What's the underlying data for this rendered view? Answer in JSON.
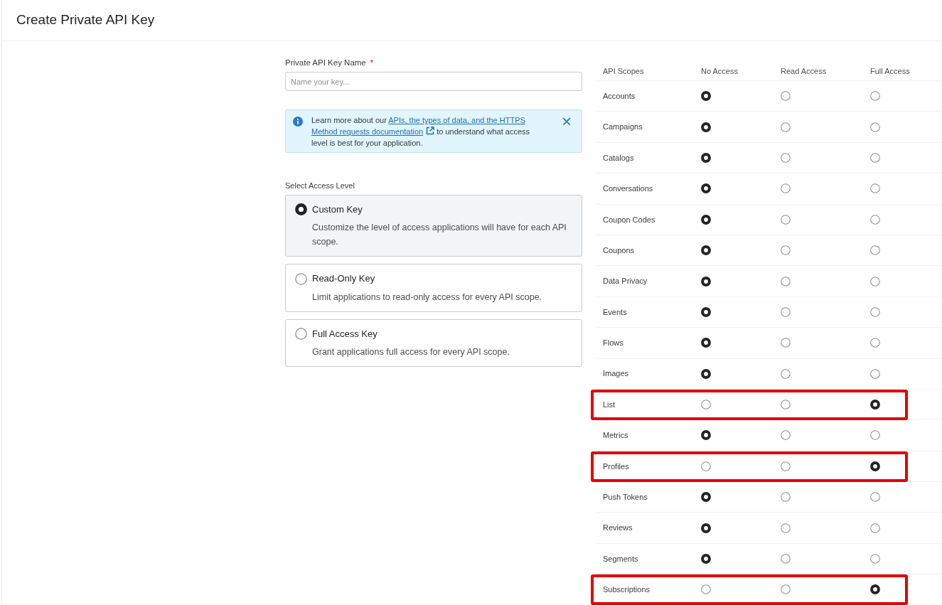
{
  "page": {
    "title": "Create Private API Key"
  },
  "name_field": {
    "label": "Private API Key Name",
    "required_mark": "*",
    "placeholder": "Name your key..."
  },
  "info_banner": {
    "before": "Learn more about our ",
    "link_lines": [
      "APIs, the types of data, and the HTTPS",
      "Method requests documentation"
    ],
    "after": " to understand what access level is best for your application.",
    "close": "×"
  },
  "access_level": {
    "label": "Select Access Level",
    "options": [
      {
        "title": "Custom Key",
        "description": "Customize the level of access applications will have for each API scope.",
        "selected": true
      },
      {
        "title": "Read-Only Key",
        "description": "Limit applications to read-only access for every API scope.",
        "selected": false
      },
      {
        "title": "Full Access Key",
        "description": "Grant applications full access for every API scope.",
        "selected": false
      }
    ]
  },
  "table": {
    "columns": [
      {
        "label": "API Scopes",
        "kind": "scope"
      },
      {
        "label": "No Access",
        "kind": "none"
      },
      {
        "label": "Read Access",
        "kind": "read"
      },
      {
        "label": "Full Access",
        "kind": "full"
      }
    ],
    "rows": [
      {
        "scope": "Accounts",
        "options": [
          {
            "selected": true
          },
          {
            "selected": false
          },
          {
            "selected": false
          }
        ],
        "highlighted": false
      },
      {
        "scope": "Campaigns",
        "options": [
          {
            "selected": true
          },
          {
            "selected": false
          },
          {
            "selected": false
          }
        ],
        "highlighted": false
      },
      {
        "scope": "Catalogs",
        "options": [
          {
            "selected": true
          },
          {
            "selected": false
          },
          {
            "selected": false
          }
        ],
        "highlighted": false
      },
      {
        "scope": "Conversations",
        "options": [
          {
            "selected": true
          },
          {
            "selected": false
          },
          {
            "selected": false
          }
        ],
        "highlighted": false
      },
      {
        "scope": "Coupon Codes",
        "options": [
          {
            "selected": true
          },
          {
            "selected": false
          },
          {
            "selected": false
          }
        ],
        "highlighted": false
      },
      {
        "scope": "Coupons",
        "options": [
          {
            "selected": true
          },
          {
            "selected": false
          },
          {
            "selected": false
          }
        ],
        "highlighted": false
      },
      {
        "scope": "Data Privacy",
        "options": [
          {
            "selected": true
          },
          {
            "selected": false
          },
          {
            "selected": false
          }
        ],
        "highlighted": false
      },
      {
        "scope": "Events",
        "options": [
          {
            "selected": true
          },
          {
            "selected": false
          },
          {
            "selected": false
          }
        ],
        "highlighted": false
      },
      {
        "scope": "Flows",
        "options": [
          {
            "selected": true
          },
          {
            "selected": false
          },
          {
            "selected": false
          }
        ],
        "highlighted": false
      },
      {
        "scope": "Images",
        "options": [
          {
            "selected": true
          },
          {
            "selected": false
          },
          {
            "selected": false
          }
        ],
        "highlighted": false
      },
      {
        "scope": "List",
        "options": [
          {
            "selected": false
          },
          {
            "selected": false
          },
          {
            "selected": true
          }
        ],
        "highlighted": true
      },
      {
        "scope": "Metrics",
        "options": [
          {
            "selected": true
          },
          {
            "selected": false
          },
          {
            "selected": false
          }
        ],
        "highlighted": false
      },
      {
        "scope": "Profiles",
        "options": [
          {
            "selected": false
          },
          {
            "selected": false
          },
          {
            "selected": true
          }
        ],
        "highlighted": true
      },
      {
        "scope": "Push Tokens",
        "options": [
          {
            "selected": true
          },
          {
            "selected": false
          },
          {
            "selected": false
          }
        ],
        "highlighted": false
      },
      {
        "scope": "Reviews",
        "options": [
          {
            "selected": true
          },
          {
            "selected": false
          },
          {
            "selected": false
          }
        ],
        "highlighted": false
      },
      {
        "scope": "Segments",
        "options": [
          {
            "selected": true
          },
          {
            "selected": false
          },
          {
            "selected": false
          }
        ],
        "highlighted": false
      },
      {
        "scope": "Subscriptions",
        "options": [
          {
            "selected": false
          },
          {
            "selected": false
          },
          {
            "selected": true
          }
        ],
        "highlighted": true
      }
    ]
  }
}
